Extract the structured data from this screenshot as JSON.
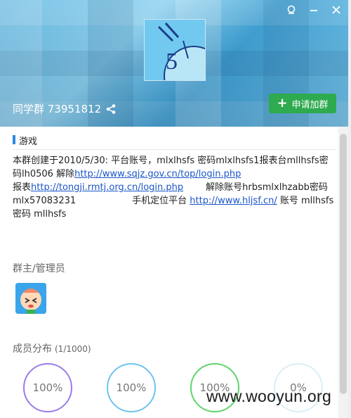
{
  "header": {
    "group_name": "同学群 73951812",
    "join_label": "申请加群",
    "avatar_digits": "5"
  },
  "section": {
    "title": "游戏"
  },
  "description": {
    "line1": "本群创建于2010/5/30:  平台账号，mlxlhsfs  密码mlxlhsfs1报表台mllhsfs密码lh0506 解除",
    "link1": "http://www.sqjz.gov.cn/top/login.php",
    "line2_prefix": "报表",
    "link2": "http://tongji.rmtj.org.cn/login.php",
    "line2_suffix": "解除账号hrbsmlxlhzabb密码",
    "line3_prefix": "mlx57083231",
    "line3_mid": "手机定位平台",
    "link3": "http://www.hljsf.cn/",
    "line3_suffix": "账号 mllhsfs 密码 mllhsfs"
  },
  "admins": {
    "title": "群主/管理员"
  },
  "members": {
    "title": "成员分布",
    "count": "(1/1000)",
    "rings": [
      {
        "label": "100%",
        "color": "#9b7ce8",
        "value": 100
      },
      {
        "label": "100%",
        "color": "#6fc3ef",
        "value": 100
      },
      {
        "label": "100%",
        "color": "#5fd46a",
        "value": 100
      },
      {
        "label": "0%",
        "color": "#dbeef5",
        "value": 0
      }
    ]
  },
  "watermark": "www.wooyun.org",
  "icons": {
    "window_1": "pin-icon",
    "window_2": "minimize-icon",
    "window_3": "close-icon",
    "share": "share-icon"
  }
}
